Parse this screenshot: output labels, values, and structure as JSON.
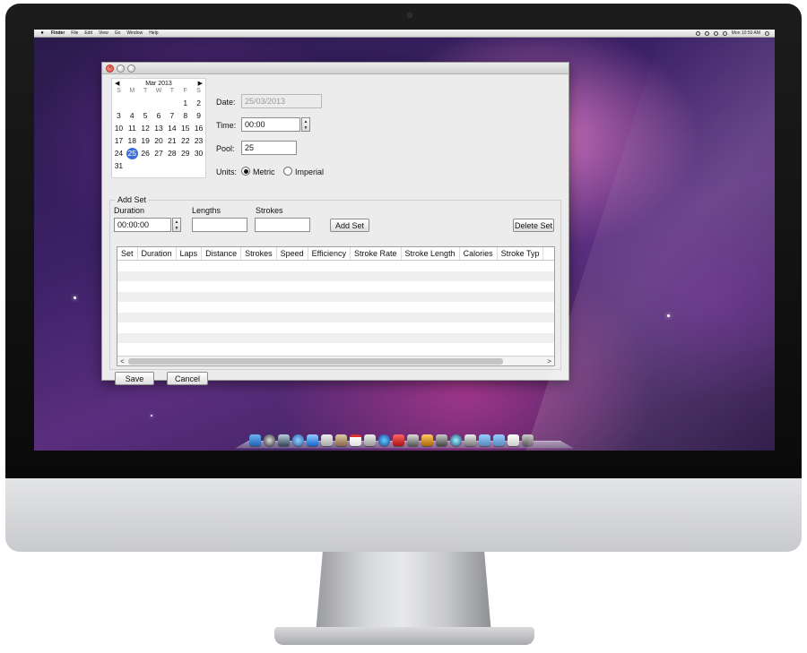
{
  "menubar": {
    "apple": "",
    "items": [
      "Finder",
      "File",
      "Edit",
      "View",
      "Go",
      "Window",
      "Help"
    ],
    "clock": "Mon 10:50 AM"
  },
  "calendar": {
    "month_label": "Mar 2013",
    "prev": "◀",
    "next": "▶",
    "dow": [
      "S",
      "M",
      "T",
      "W",
      "T",
      "F",
      "S"
    ],
    "weeks": [
      [
        "",
        "",
        "",
        "",
        "",
        "1",
        "2"
      ],
      [
        "3",
        "4",
        "5",
        "6",
        "7",
        "8",
        "9"
      ],
      [
        "10",
        "11",
        "12",
        "13",
        "14",
        "15",
        "16"
      ],
      [
        "17",
        "18",
        "19",
        "20",
        "21",
        "22",
        "23"
      ],
      [
        "24",
        "25",
        "26",
        "27",
        "28",
        "29",
        "30"
      ],
      [
        "31",
        "",
        "",
        "",
        "",
        "",
        ""
      ]
    ],
    "selected": "25"
  },
  "form": {
    "date_label": "Date:",
    "date_value": "25/03/2013",
    "time_label": "Time:",
    "time_value": "00:00",
    "pool_label": "Pool:",
    "pool_value": "25",
    "units_label": "Units:",
    "metric_label": "Metric",
    "imperial_label": "Imperial",
    "units_selected": "Metric"
  },
  "add_set": {
    "title": "Add Set",
    "duration_label": "Duration",
    "duration_value": "00:00:00",
    "lengths_label": "Lengths",
    "lengths_value": "",
    "strokes_label": "Strokes",
    "strokes_value": "",
    "add_button": "Add Set",
    "delete_button": "Delete Set"
  },
  "table": {
    "columns": [
      "Set",
      "Duration",
      "Laps",
      "Distance",
      "Strokes",
      "Speed",
      "Efficiency",
      "Stroke Rate",
      "Stroke Length",
      "Calories",
      "Stroke Typ"
    ],
    "scroll_left": "<",
    "scroll_right": ">"
  },
  "footer": {
    "save": "Save",
    "cancel": "Cancel"
  },
  "colors": {
    "selection": "#3a6fd8",
    "close_button": "#e0403a"
  }
}
